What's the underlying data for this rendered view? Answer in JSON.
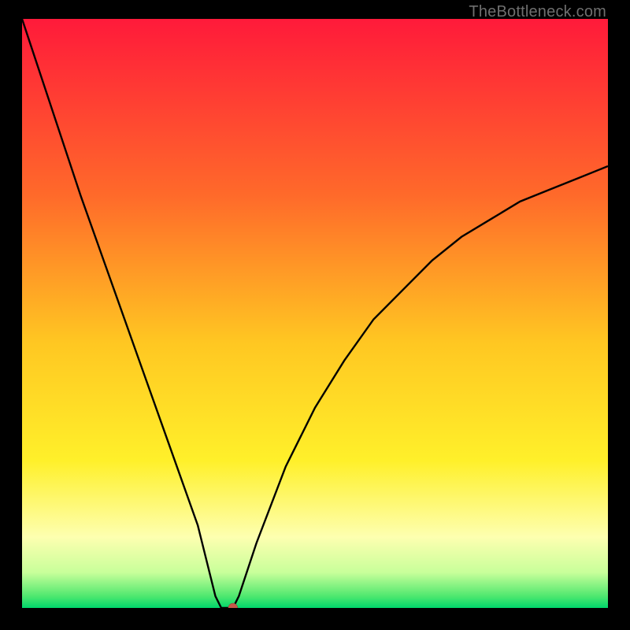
{
  "watermark": "TheBottleneck.com",
  "chart_data": {
    "type": "line",
    "title": "",
    "xlabel": "",
    "ylabel": "",
    "xlim": [
      0,
      100
    ],
    "ylim": [
      0,
      100
    ],
    "curve": [
      {
        "x": 0,
        "y": 100
      },
      {
        "x": 5,
        "y": 85
      },
      {
        "x": 10,
        "y": 70
      },
      {
        "x": 15,
        "y": 56
      },
      {
        "x": 20,
        "y": 42
      },
      {
        "x": 25,
        "y": 28
      },
      {
        "x": 30,
        "y": 14
      },
      {
        "x": 33,
        "y": 2
      },
      {
        "x": 34,
        "y": 0
      },
      {
        "x": 36,
        "y": 0
      },
      {
        "x": 37,
        "y": 2
      },
      {
        "x": 40,
        "y": 11
      },
      {
        "x": 45,
        "y": 24
      },
      {
        "x": 50,
        "y": 34
      },
      {
        "x": 55,
        "y": 42
      },
      {
        "x": 60,
        "y": 49
      },
      {
        "x": 65,
        "y": 54
      },
      {
        "x": 70,
        "y": 59
      },
      {
        "x": 75,
        "y": 63
      },
      {
        "x": 80,
        "y": 66
      },
      {
        "x": 85,
        "y": 69
      },
      {
        "x": 90,
        "y": 71
      },
      {
        "x": 95,
        "y": 73
      },
      {
        "x": 100,
        "y": 75
      }
    ],
    "marker": {
      "x": 36,
      "y": 0
    },
    "gradient_stops": [
      {
        "offset": 0,
        "color": "#ff1a3a"
      },
      {
        "offset": 30,
        "color": "#ff6a2a"
      },
      {
        "offset": 55,
        "color": "#ffc722"
      },
      {
        "offset": 75,
        "color": "#fff02a"
      },
      {
        "offset": 88,
        "color": "#fdffb0"
      },
      {
        "offset": 94,
        "color": "#c8ff9a"
      },
      {
        "offset": 98,
        "color": "#4fe86f"
      },
      {
        "offset": 100,
        "color": "#00d66b"
      }
    ]
  }
}
